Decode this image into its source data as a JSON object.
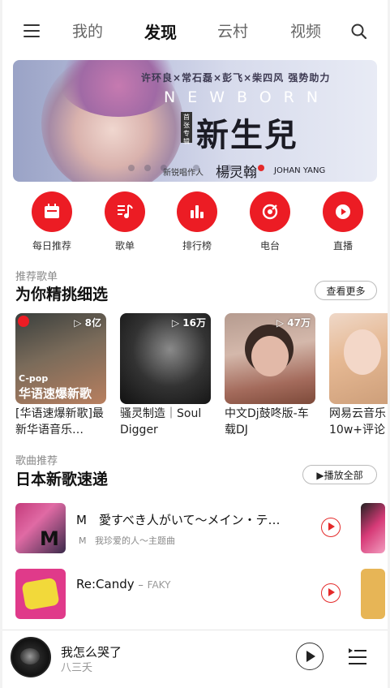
{
  "nav": {
    "menu_icon": "hamburger-menu-icon",
    "tabs": [
      {
        "label": "我的",
        "active": false
      },
      {
        "label": "发现",
        "active": true
      },
      {
        "label": "云村",
        "active": false
      },
      {
        "label": "视频",
        "active": false
      }
    ],
    "search_icon": "search-icon"
  },
  "banner": {
    "line1": "许环良×常石磊×彭飞×柴四风  强势助力",
    "newborn": "NEWBORN",
    "tag": "首张专辑",
    "title": "新生兒",
    "sub": "新锐唱作人",
    "artist": "楊灵翰",
    "artist_en": "JOHAN YANG",
    "dots": 6,
    "active_dot": 5
  },
  "quick_entries": [
    {
      "label": "每日推荐",
      "icon": "calendar-icon"
    },
    {
      "label": "歌单",
      "icon": "playlist-note-icon"
    },
    {
      "label": "排行榜",
      "icon": "bar-chart-icon"
    },
    {
      "label": "电台",
      "icon": "radio-icon"
    },
    {
      "label": "直播",
      "icon": "live-play-icon"
    }
  ],
  "recommend_playlists": {
    "subtitle": "推荐歌单",
    "title": "为你精挑细选",
    "more_label": "查看更多",
    "items": [
      {
        "count": "8亿",
        "title": "[华语速爆新歌]最新华语音乐…",
        "cover_caption": "华语速爆新歌",
        "cover_tag": "C-pop"
      },
      {
        "count": "16万",
        "title": "骚灵制造｜Soul Digger"
      },
      {
        "count": "47万",
        "title": "中文Dj鼓咚版-车载DJ"
      },
      {
        "count": "",
        "title": "网易云音乐10w+评论"
      }
    ]
  },
  "new_songs": {
    "subtitle": "歌曲推荐",
    "title": "日本新歌速递",
    "play_all_label": "播放全部",
    "items": [
      {
        "title": "M　愛すべき人がいて～メイン・テ…",
        "sub_tag": "M",
        "sub": "我珍爱的人～主题曲"
      },
      {
        "title": "Re:Candy",
        "dash": "–",
        "artist": "FAKY"
      }
    ]
  },
  "player": {
    "title": "我怎么哭了",
    "artist": "八三夭"
  },
  "colors": {
    "accent": "#ec1c24",
    "text": "#222222",
    "muted": "#888888"
  }
}
